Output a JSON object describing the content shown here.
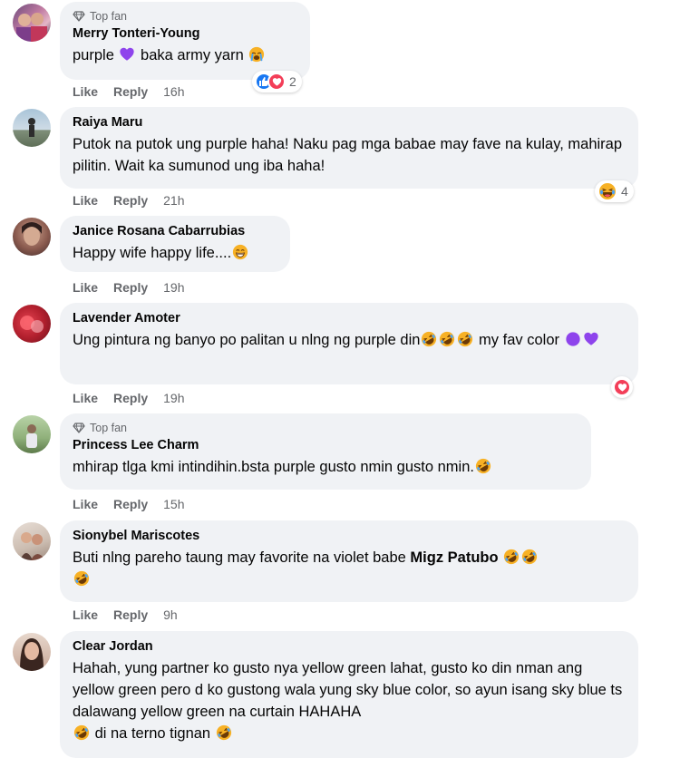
{
  "colors": {
    "bubble": "#f0f2f5",
    "meta": "#65676b",
    "like_blue": "#1877f2",
    "love_red": "#f33e58",
    "purple_heart": "#8e44ec",
    "haha_yellow": "#f7b125"
  },
  "comments": [
    {
      "badge": "Top fan",
      "author": "Merry Tonteri-Young",
      "text": [
        "purple ",
        " baka army yarn "
      ],
      "like": "Like",
      "reply": "Reply",
      "time": "16h",
      "reaction_count": "2"
    },
    {
      "author": "Raiya Maru",
      "text": [
        "Putok na putok ung purple haha! Naku pag mga babae may fave na kulay, mahirap pilitin. Wait ka sumunod ung iba haha!"
      ],
      "like": "Like",
      "reply": "Reply",
      "time": "21h",
      "reaction_count": "4"
    },
    {
      "author": "Janice Rosana Cabarrubias",
      "text": [
        "Happy wife happy life...."
      ],
      "like": "Like",
      "reply": "Reply",
      "time": "19h"
    },
    {
      "author": "Lavender Amoter",
      "text": [
        "Ung pintura ng banyo po palitan u nlng ng purple din",
        " my fav color "
      ],
      "like": "Like",
      "reply": "Reply",
      "time": "19h"
    },
    {
      "badge": "Top fan",
      "author": "Princess Lee Charm",
      "text": [
        "mhirap tlga kmi intindihin.bsta purple gusto nmin gusto nmin."
      ],
      "like": "Like",
      "reply": "Reply",
      "time": "15h"
    },
    {
      "author": "Sionybel Mariscotes",
      "text": [
        "Buti nlng pareho taung may favorite na violet babe ",
        "Migz Patubo"
      ],
      "like": "Like",
      "reply": "Reply",
      "time": "9h"
    },
    {
      "author": "Clear Jordan",
      "text": [
        "Hahah, yung partner ko gusto nya yellow green lahat, gusto ko din nman ang yellow green pero d ko gustong wala yung sky blue color, so ayun isang sky blue ts dalawang yellow green na curtain HAHAHA",
        " di na terno tignan "
      ]
    }
  ]
}
